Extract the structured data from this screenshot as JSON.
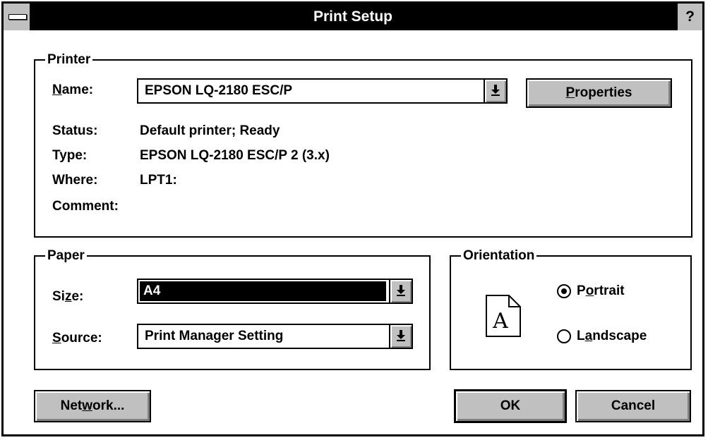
{
  "window": {
    "title": "Print Setup",
    "help_label": "?"
  },
  "printer": {
    "group_label": "Printer",
    "name_label": {
      "pre": "",
      "u": "N",
      "post": "ame:"
    },
    "name_value": "EPSON LQ-2180 ESC/P",
    "properties_label": {
      "pre": "",
      "u": "P",
      "post": "roperties"
    },
    "status_label": "Status:",
    "status_value": "Default printer; Ready",
    "type_label": "Type:",
    "type_value": "EPSON LQ-2180 ESC/P 2 (3.x)",
    "where_label": "Where:",
    "where_value": "LPT1:",
    "comment_label": "Comment:",
    "comment_value": ""
  },
  "paper": {
    "group_label": "Paper",
    "size_label": {
      "pre": "Si",
      "u": "z",
      "post": "e:"
    },
    "size_value": "A4",
    "source_label": {
      "pre": "",
      "u": "S",
      "post": "ource:"
    },
    "source_value": "Print Manager Setting"
  },
  "orientation": {
    "group_label": "Orientation",
    "icon_letter": "A",
    "portrait_label": {
      "pre": "P",
      "u": "o",
      "post": "rtrait"
    },
    "landscape_label": {
      "pre": "L",
      "u": "a",
      "post": "ndscape"
    },
    "selected": "portrait"
  },
  "buttons": {
    "network_label": {
      "pre": "Net",
      "u": "w",
      "post": "ork..."
    },
    "ok_label": "OK",
    "cancel_label": "Cancel"
  },
  "icons": {
    "dropdown": "chevron-down-icon",
    "system_menu": "system-menu-icon"
  },
  "colors": {
    "titlebar": "#000000",
    "button_face": "#c0c0c0",
    "selection": "#000000"
  }
}
